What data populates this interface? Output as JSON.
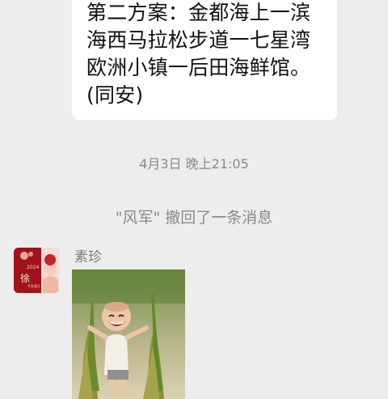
{
  "previous_message": {
    "text": "第二方案：金都海上一滨\n海西马拉松步道一七星湾\n欧洲小镇一后田海鲜馆。\n(同安)"
  },
  "timestamp": "4月3日 晚上21:05",
  "recall_notice": "\"风军\" 撤回了一条消息",
  "sender": {
    "name": "素珍",
    "avatar_year": "2024",
    "avatar_char": "徐",
    "avatar_caption": "平安喜乐"
  },
  "sticker": {
    "icon": "child-with-rice-bundles-sticker"
  },
  "colors": {
    "background": "#ededed",
    "bubble": "#ffffff",
    "meta_text": "#8a8a8a",
    "avatar_red": "#a1121d"
  }
}
